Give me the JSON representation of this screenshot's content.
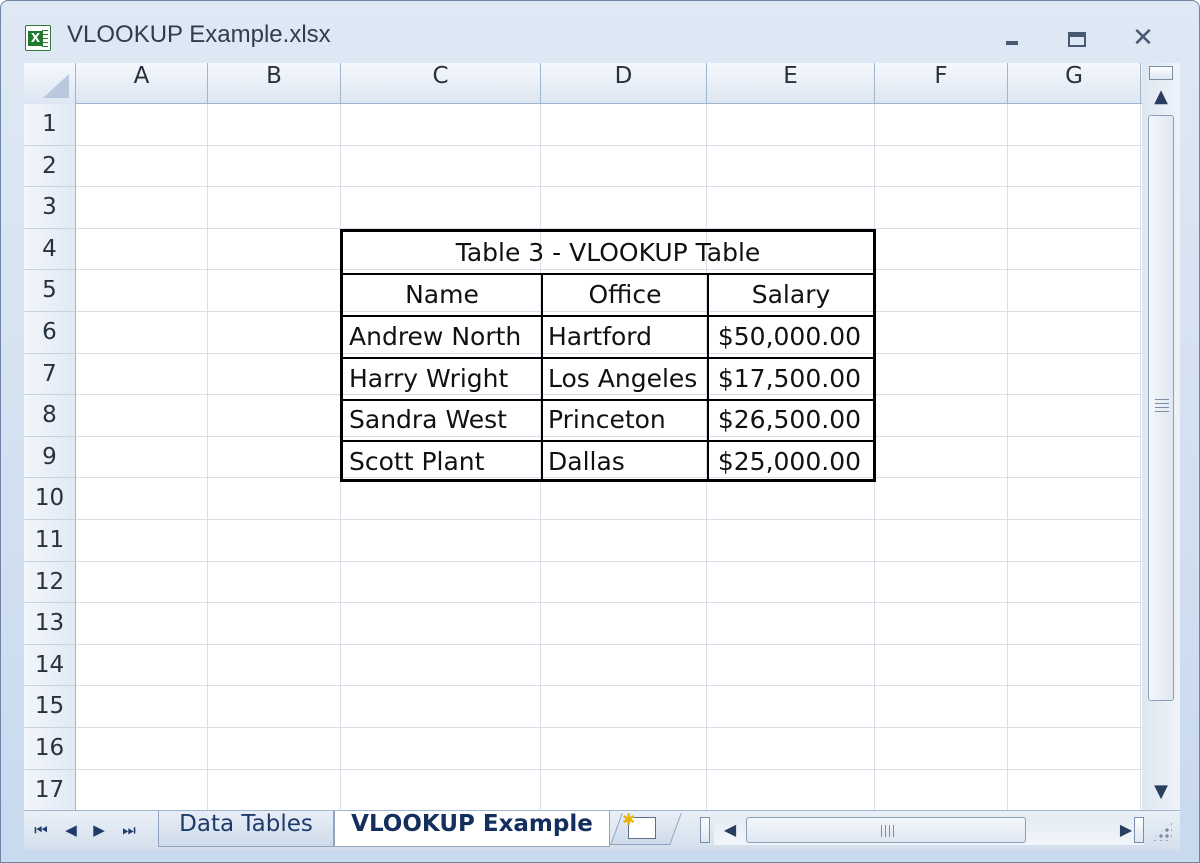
{
  "window": {
    "title": "VLOOKUP Example.xlsx",
    "minimize_icon": "minimize-icon",
    "maximize_icon": "maximize-icon",
    "close_icon": "close-icon"
  },
  "grid": {
    "columns": [
      "A",
      "B",
      "C",
      "D",
      "E",
      "F",
      "G"
    ],
    "rows": [
      "1",
      "2",
      "3",
      "4",
      "5",
      "6",
      "7",
      "8",
      "9",
      "10",
      "11",
      "12",
      "13",
      "14",
      "15",
      "16",
      "17"
    ]
  },
  "table": {
    "title": "Table 3 - VLOOKUP Table",
    "headers": [
      "Name",
      "Office",
      "Salary"
    ],
    "rows": [
      [
        "Andrew North",
        "Hartford",
        "$50,000.00"
      ],
      [
        "Harry Wright",
        "Los Angeles",
        "$17,500.00"
      ],
      [
        "Sandra West",
        "Princeton",
        "$26,500.00"
      ],
      [
        "Scott Plant",
        "Dallas",
        "$25,000.00"
      ]
    ]
  },
  "sheets": {
    "tabs": [
      "Data Tables",
      "VLOOKUP Example"
    ],
    "active": "VLOOKUP Example",
    "nav": [
      "⏮",
      "◀",
      "▶",
      "⏭"
    ]
  },
  "colors": {
    "frame": "#c9d9ee",
    "header": "#dde6f2",
    "gridline": "#d9dfe8",
    "tab_text": "#1f3b6b"
  }
}
